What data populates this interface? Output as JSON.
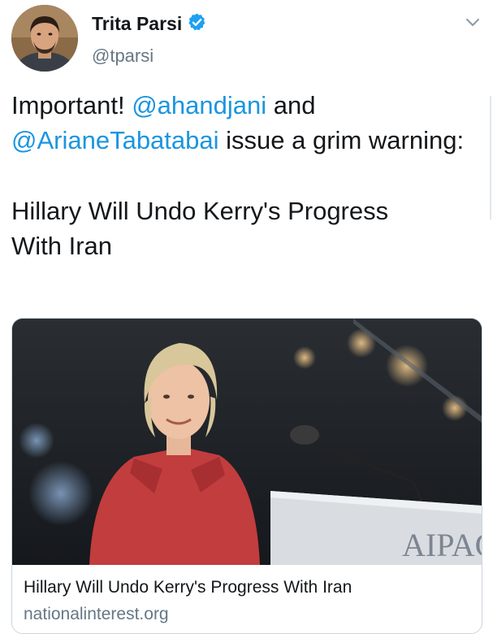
{
  "author": {
    "name": "Trita Parsi",
    "handle": "@tparsi",
    "verified": true,
    "avatar_icon": "profile-photo"
  },
  "menu": {
    "icon": "chevron-down-icon"
  },
  "tweet": {
    "intro": "Important!",
    "mention_1": "@ahandjani",
    "connector": "and",
    "mention_2": "@ArianeTabatabai",
    "rest": "issue a grim warning:",
    "headline_line_1": "Hillary Will Undo Kerry's Progress",
    "headline_line_2": "With Iran"
  },
  "card": {
    "image_icon": "article-photo",
    "image_text": "AIPAC",
    "title": "Hillary Will Undo Kerry's Progress With Iran",
    "domain": "nationalinterest.org"
  },
  "colors": {
    "link": "#1b95e0",
    "text": "#14171a",
    "secondary": "#657786",
    "border": "#ccd6dd"
  }
}
